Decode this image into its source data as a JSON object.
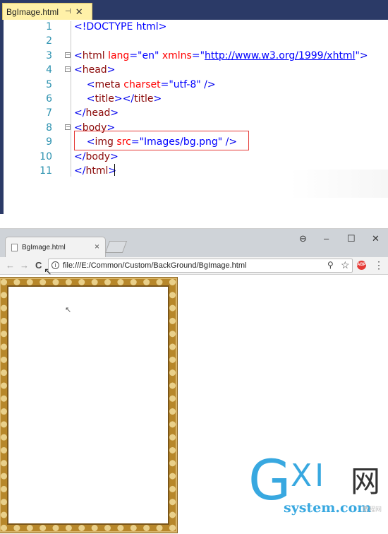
{
  "editor": {
    "tab_title": "BgImage.html",
    "tab_pin": "⊣",
    "tab_close": "✕",
    "lines": [
      {
        "n": "1",
        "fold": "",
        "parts": [
          {
            "t": "<!DOCTYPE html>",
            "c": "doctype"
          }
        ]
      },
      {
        "n": "2",
        "fold": "",
        "parts": []
      },
      {
        "n": "3",
        "fold": "⊟",
        "parts": [
          {
            "t": "<",
            "c": "bracket"
          },
          {
            "t": "html",
            "c": "tag"
          },
          {
            "t": " lang",
            "c": "attr"
          },
          {
            "t": "=",
            "c": "eq"
          },
          {
            "t": "\"en\"",
            "c": "val"
          },
          {
            "t": " xmlns",
            "c": "attr"
          },
          {
            "t": "=",
            "c": "eq"
          },
          {
            "t": "\"",
            "c": "val"
          },
          {
            "t": "http://www.w3.org/1999/xhtml",
            "c": "url"
          },
          {
            "t": "\"",
            "c": "val"
          },
          {
            "t": ">",
            "c": "bracket"
          }
        ]
      },
      {
        "n": "4",
        "fold": "⊟",
        "parts": [
          {
            "t": "<",
            "c": "bracket"
          },
          {
            "t": "head",
            "c": "tag"
          },
          {
            "t": ">",
            "c": "bracket"
          }
        ]
      },
      {
        "n": "5",
        "fold": "",
        "parts": [
          {
            "t": "    <",
            "c": "bracket"
          },
          {
            "t": "meta",
            "c": "tag"
          },
          {
            "t": " charset",
            "c": "attr"
          },
          {
            "t": "=",
            "c": "eq"
          },
          {
            "t": "\"utf-8\"",
            "c": "val"
          },
          {
            "t": " />",
            "c": "bracket"
          }
        ]
      },
      {
        "n": "6",
        "fold": "",
        "parts": [
          {
            "t": "    <",
            "c": "bracket"
          },
          {
            "t": "title",
            "c": "tag"
          },
          {
            "t": "></",
            "c": "bracket"
          },
          {
            "t": "title",
            "c": "tag"
          },
          {
            "t": ">",
            "c": "bracket"
          }
        ]
      },
      {
        "n": "7",
        "fold": "",
        "parts": [
          {
            "t": "</",
            "c": "bracket"
          },
          {
            "t": "head",
            "c": "tag"
          },
          {
            "t": ">",
            "c": "bracket"
          }
        ]
      },
      {
        "n": "8",
        "fold": "⊟",
        "parts": [
          {
            "t": "<",
            "c": "bracket"
          },
          {
            "t": "body",
            "c": "tag"
          },
          {
            "t": ">",
            "c": "bracket"
          }
        ]
      },
      {
        "n": "9",
        "fold": "",
        "parts": [
          {
            "t": "    <",
            "c": "bracket"
          },
          {
            "t": "img",
            "c": "tag"
          },
          {
            "t": " src",
            "c": "attr"
          },
          {
            "t": "=",
            "c": "eq"
          },
          {
            "t": "\"Images/bg.png\"",
            "c": "val"
          },
          {
            "t": " />",
            "c": "bracket"
          }
        ]
      },
      {
        "n": "10",
        "fold": "",
        "parts": [
          {
            "t": "</",
            "c": "bracket"
          },
          {
            "t": "body",
            "c": "tag"
          },
          {
            "t": ">",
            "c": "bracket"
          }
        ]
      },
      {
        "n": "11",
        "fold": "",
        "parts": [
          {
            "t": "</",
            "c": "bracket"
          },
          {
            "t": "html",
            "c": "tag"
          },
          {
            "t": ">",
            "c": "bracket"
          }
        ]
      }
    ]
  },
  "browser": {
    "tab_title": "BgImage.html",
    "tab_close": "×",
    "window_controls": {
      "account": "⊖",
      "minimize": "–",
      "maximize": "☐",
      "close": "✕"
    },
    "nav": {
      "back": "←",
      "forward": "→",
      "reload": "C"
    },
    "address": "file:///E:/Common/Custom/BackGround/BgImage.html",
    "info_icon": "i",
    "zoom_icon": "⚲",
    "star_icon": "☆",
    "abp_label": "ABP",
    "menu_icon": "⋮"
  },
  "watermark": {
    "g": "G",
    "xi": "XI",
    "net": "网",
    "sub": "system.com",
    "tag": "教程网"
  },
  "colors": {
    "editor_bar": "#2b3a67",
    "tab_active": "#fff1a8",
    "highlight_box": "#e53935",
    "frame_gold": "#b7872a",
    "watermark_blue": "#38a8e0"
  }
}
